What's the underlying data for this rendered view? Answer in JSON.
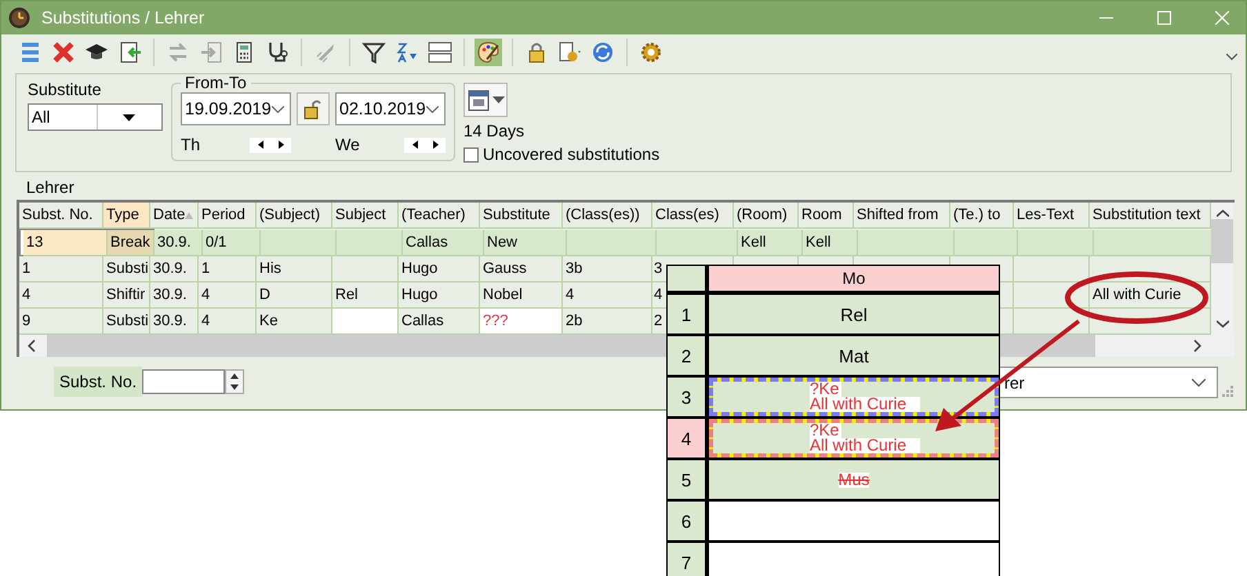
{
  "window": {
    "title": "Substitutions / Lehrer"
  },
  "toolbar": [
    {
      "kind": "rows",
      "disabled": false,
      "on": false
    },
    {
      "kind": "delete",
      "disabled": false,
      "on": false
    },
    {
      "kind": "cap",
      "disabled": false,
      "on": false
    },
    {
      "kind": "import",
      "disabled": false,
      "on": false
    },
    {
      "kind": "separator"
    },
    {
      "kind": "swap",
      "disabled": true,
      "on": false
    },
    {
      "kind": "export",
      "disabled": true,
      "on": false
    },
    {
      "kind": "calculator",
      "disabled": false,
      "on": false
    },
    {
      "kind": "stethoscope",
      "disabled": false,
      "on": false
    },
    {
      "kind": "separator"
    },
    {
      "kind": "rocket",
      "disabled": true,
      "on": false
    },
    {
      "kind": "separator"
    },
    {
      "kind": "filter",
      "disabled": false,
      "on": false
    },
    {
      "kind": "sort",
      "disabled": false,
      "on": false
    },
    {
      "kind": "grid",
      "disabled": false,
      "on": false
    },
    {
      "kind": "separator"
    },
    {
      "kind": "palette",
      "disabled": false,
      "on": true
    },
    {
      "kind": "separator"
    },
    {
      "kind": "lock",
      "disabled": false,
      "on": false
    },
    {
      "kind": "docgear",
      "disabled": false,
      "on": false
    },
    {
      "kind": "refresh",
      "disabled": false,
      "on": false
    },
    {
      "kind": "separator"
    },
    {
      "kind": "gear",
      "disabled": false,
      "on": false
    }
  ],
  "filter": {
    "substitute_label": "Substitute",
    "substitute_value": "All",
    "range_label": "From-To",
    "from": "19.09.2019",
    "from_day": "Th",
    "to": "02.10.2019",
    "to_day": "We",
    "span": "14 Days",
    "uncovered": {
      "label": "Uncovered substitutions",
      "checked": false
    }
  },
  "table_title": "Lehrer",
  "table": {
    "columns": [
      {
        "label": "Subst. No.",
        "highlighted": false,
        "sorted": false
      },
      {
        "label": "Type",
        "highlighted": true,
        "sorted": false
      },
      {
        "label": "Date",
        "highlighted": false,
        "sorted": true
      },
      {
        "label": "Period",
        "highlighted": false,
        "sorted": false
      },
      {
        "label": "(Subject)",
        "highlighted": false,
        "sorted": false
      },
      {
        "label": "Subject",
        "highlighted": false,
        "sorted": false
      },
      {
        "label": "(Teacher)",
        "highlighted": false,
        "sorted": false
      },
      {
        "label": "Substitute",
        "highlighted": false,
        "sorted": false
      },
      {
        "label": "(Class(es))",
        "highlighted": false,
        "sorted": false
      },
      {
        "label": "Class(es)",
        "highlighted": false,
        "sorted": false
      },
      {
        "label": "(Room)",
        "highlighted": false,
        "sorted": false
      },
      {
        "label": "Room",
        "highlighted": false,
        "sorted": false
      },
      {
        "label": "Shifted from",
        "highlighted": false,
        "sorted": false
      },
      {
        "label": "(Te.) to",
        "highlighted": false,
        "sorted": false
      },
      {
        "label": "Les-Text",
        "highlighted": false,
        "sorted": false
      },
      {
        "label": "Substitution text",
        "highlighted": false,
        "sorted": false
      }
    ],
    "rows": [
      {
        "selected": true,
        "uncovered": false,
        "cells": [
          "13",
          "Break",
          "30.9.",
          "0/1",
          null,
          null,
          "Callas",
          "New",
          null,
          null,
          "Kell",
          "Kell",
          null,
          null,
          null,
          null
        ]
      },
      {
        "selected": false,
        "uncovered": false,
        "cells": [
          "1",
          "Substi",
          "30.9.",
          "1",
          "His",
          null,
          "Hugo",
          "Gauss",
          "3b",
          "3",
          null,
          null,
          null,
          null,
          null,
          null
        ]
      },
      {
        "selected": false,
        "uncovered": false,
        "cells": [
          "4",
          "Shiftir",
          "30.9.",
          "4",
          "D",
          "Rel",
          "Hugo",
          "Nobel",
          "4",
          "4",
          null,
          null,
          null,
          null,
          null,
          "All with Curie"
        ]
      },
      {
        "selected": false,
        "uncovered": true,
        "cells": [
          "9",
          "Substi",
          "30.9.",
          "4",
          "Ke",
          null,
          "Callas",
          "???",
          "2b",
          "2",
          null,
          null,
          null,
          null,
          null,
          null
        ]
      }
    ]
  },
  "footer": {
    "number_label": "Subst. No.",
    "view_value": "rer"
  },
  "timetable": {
    "day": "Mo",
    "periods": [
      {
        "number": "1",
        "kind": "regular",
        "lines": [
          "Rel"
        ],
        "selected": false
      },
      {
        "number": "2",
        "kind": "regular",
        "lines": [
          "Mat"
        ],
        "selected": false
      },
      {
        "number": "3",
        "kind": "substitution",
        "lines": [
          "?Ke",
          "All with Curie"
        ],
        "selected": false
      },
      {
        "number": "4",
        "kind": "substitution",
        "lines": [
          "?Ke",
          "All with Curie"
        ],
        "selected": true
      },
      {
        "number": "5",
        "kind": "cancelled",
        "lines": [
          "Mus"
        ],
        "selected": false
      },
      {
        "number": "6",
        "kind": "free",
        "selected": false
      },
      {
        "number": "7",
        "kind": "free",
        "selected": false
      }
    ]
  }
}
